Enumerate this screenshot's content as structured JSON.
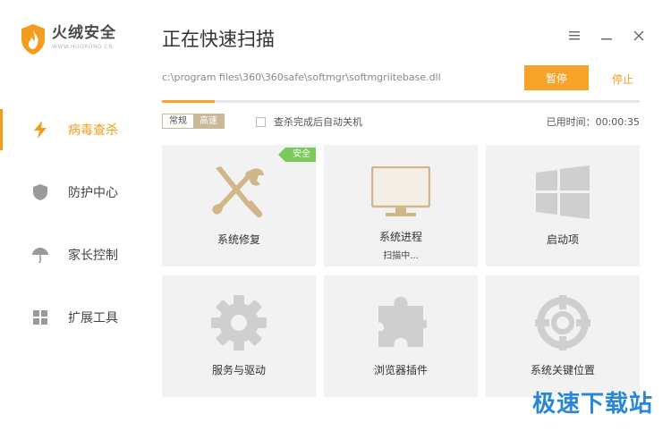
{
  "brand": {
    "title": "火绒安全",
    "subtitle": "WWW.HUORONG.CN",
    "color": "#f39c1d"
  },
  "sidebar": {
    "items": [
      {
        "label": "病毒查杀",
        "icon": "lightning-icon",
        "active": true
      },
      {
        "label": "防护中心",
        "icon": "shield-icon",
        "active": false
      },
      {
        "label": "家长控制",
        "icon": "umbrella-icon",
        "active": false
      },
      {
        "label": "扩展工具",
        "icon": "grid-icon",
        "active": false
      }
    ]
  },
  "header": {
    "title": "正在快速扫描"
  },
  "scan": {
    "path": "c:\\program files\\360\\360safe\\softmgr\\softmgriitebase.dll",
    "pause_label": "暂停",
    "stop_label": "停止",
    "progress": 0.11,
    "mode_normal": "常规",
    "mode_fast": "高速",
    "auto_shutdown_label": "查杀完成后自动关机",
    "auto_shutdown_checked": false,
    "elapsed": "已用时间：00:00:35"
  },
  "tiles": [
    {
      "label": "系统修复",
      "icon": "tools-icon",
      "badge": "安全",
      "status": ""
    },
    {
      "label": "系统进程",
      "icon": "monitor-icon",
      "badge": "",
      "status": "扫描中..."
    },
    {
      "label": "启动项",
      "icon": "windows-icon",
      "badge": "",
      "status": ""
    },
    {
      "label": "服务与驱动",
      "icon": "gear-icon",
      "badge": "",
      "status": ""
    },
    {
      "label": "浏览器插件",
      "icon": "puzzle-icon",
      "badge": "",
      "status": ""
    },
    {
      "label": "系统关键位置",
      "icon": "target-icon",
      "badge": "",
      "status": ""
    }
  ],
  "watermark": "极速下载站",
  "colors": {
    "accent": "#f39c1d",
    "button": "#f7a229",
    "tile_bg": "#f2f2f2",
    "active_icon": "#d1b68a",
    "inactive_icon": "#c9c9c9",
    "badge": "#7cc95b"
  }
}
